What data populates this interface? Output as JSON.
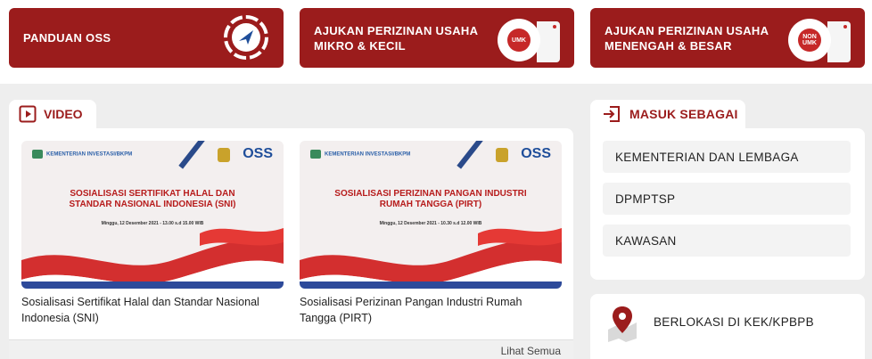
{
  "top": {
    "panduan": "PANDUAN OSS",
    "umk": "AJUKAN PERIZINAN USAHA MIKRO & KECIL",
    "umk_badge": "UMK",
    "nonumk": "AJUKAN PERIZINAN USAHA MENENGAH & BESAR",
    "nonumk_badge": "NON UMK"
  },
  "video": {
    "tab": "VIDEO",
    "items": [
      {
        "thumb_ministry": "KEMENTERIAN INVESTASI/BKPM",
        "thumb_title": "SOSIALISASI SERTIFIKAT HALAL DAN STANDAR NASIONAL INDONESIA (SNI)",
        "thumb_date": "Minggu, 12 Desember 2021 - 13.00 s.d 15.00 WIB",
        "caption": "Sosialisasi Sertifikat Halal dan Standar Nasional Indonesia (SNI)"
      },
      {
        "thumb_ministry": "KEMENTERIAN INVESTASI/BKPM",
        "thumb_title": "SOSIALISASI PERIZINAN PANGAN INDUSTRI RUMAH TANGGA (PIRT)",
        "thumb_date": "Minggu, 12 Desember 2021 - 10.30 s.d 12.00 WIB",
        "caption": "Sosialisasi Perizinan Pangan Industri Rumah Tangga (PIRT)"
      }
    ],
    "oss_logo": "OSS",
    "more": "Lihat Semua"
  },
  "login": {
    "tab": "MASUK SEBAGAI",
    "items": [
      "KEMENTERIAN DAN LEMBAGA",
      "DPMPTSP",
      "KAWASAN"
    ]
  },
  "kek": {
    "label": "BERLOKASI DI KEK/KPBPB"
  },
  "colors": {
    "brand": "#9b1c1c",
    "accent_blue": "#1f4e9a"
  }
}
